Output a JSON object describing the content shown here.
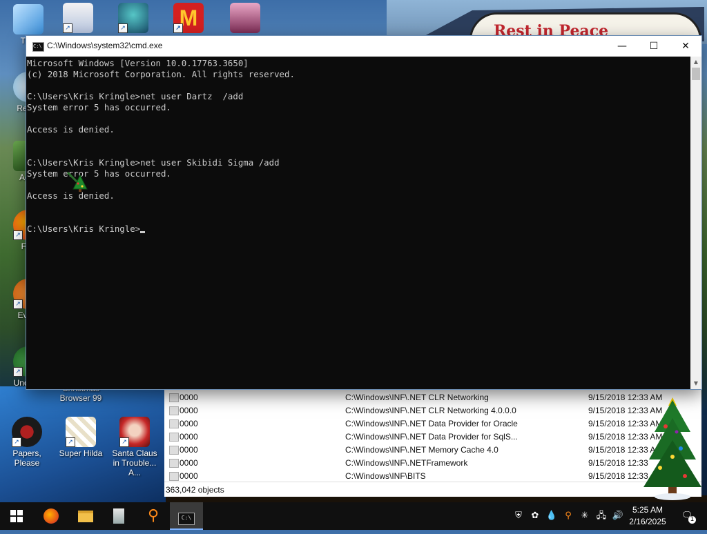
{
  "desktop": {
    "sign_text": "Rest in Peace",
    "icons": [
      {
        "label": "This",
        "id": "this-pc"
      },
      {
        "label": "Recyc",
        "id": "recycle-bin"
      },
      {
        "label": "Activ",
        "id": "activ"
      },
      {
        "label": "Fire",
        "id": "firefox"
      },
      {
        "label": "Every",
        "id": "everything"
      },
      {
        "label": "Underta",
        "id": "undertale"
      },
      {
        "label": "Christmas Browser 99",
        "id": "christmas-browser"
      },
      {
        "label": "Papers, Please",
        "id": "papers-please"
      },
      {
        "label": "Super Hilda",
        "id": "super-hilda"
      },
      {
        "label": "Santa Claus in Trouble... A...",
        "id": "santa-claus"
      }
    ]
  },
  "cmd": {
    "title": "C:\\Windows\\system32\\cmd.exe",
    "minimize": "—",
    "maximize": "☐",
    "close": "✕",
    "lines": [
      "Microsoft Windows [Version 10.0.17763.3650]",
      "(c) 2018 Microsoft Corporation. All rights reserved.",
      "",
      "C:\\Users\\Kris Kringle>net user Dartz  /add",
      "System error 5 has occurred.",
      "",
      "Access is denied.",
      "",
      "",
      "C:\\Users\\Kris Kringle>net user Skibidi Sigma /add",
      "System error 5 has occurred.",
      "",
      "Access is denied.",
      "",
      "",
      "C:\\Users\\Kris Kringle>"
    ]
  },
  "filelist": {
    "rows": [
      {
        "name": "0000",
        "path": "C:\\Windows\\INF\\.NET CLR Networking",
        "date": "9/15/2018 12:33 AM"
      },
      {
        "name": "0000",
        "path": "C:\\Windows\\INF\\.NET CLR Networking 4.0.0.0",
        "date": "9/15/2018 12:33 AM"
      },
      {
        "name": "0000",
        "path": "C:\\Windows\\INF\\.NET Data Provider for Oracle",
        "date": "9/15/2018 12:33 AM"
      },
      {
        "name": "0000",
        "path": "C:\\Windows\\INF\\.NET Data Provider for SqlS...",
        "date": "9/15/2018 12:33 AM"
      },
      {
        "name": "0000",
        "path": "C:\\Windows\\INF\\.NET Memory Cache 4.0",
        "date": "9/15/2018 12:33 AM"
      },
      {
        "name": "0000",
        "path": "C:\\Windows\\INF\\.NETFramework",
        "date": "9/15/2018 12:33"
      },
      {
        "name": "0000",
        "path": "C:\\Windows\\INF\\BITS",
        "date": "9/15/2018 12:33"
      }
    ],
    "status": "363,042 objects"
  },
  "taskbar": {
    "time": "5:25 AM",
    "date": "2/16/2025",
    "notification_count": "1"
  },
  "colors": {
    "console_bg": "#0c0c0c",
    "console_fg": "#cccccc",
    "taskbar_bg": "#101010"
  }
}
